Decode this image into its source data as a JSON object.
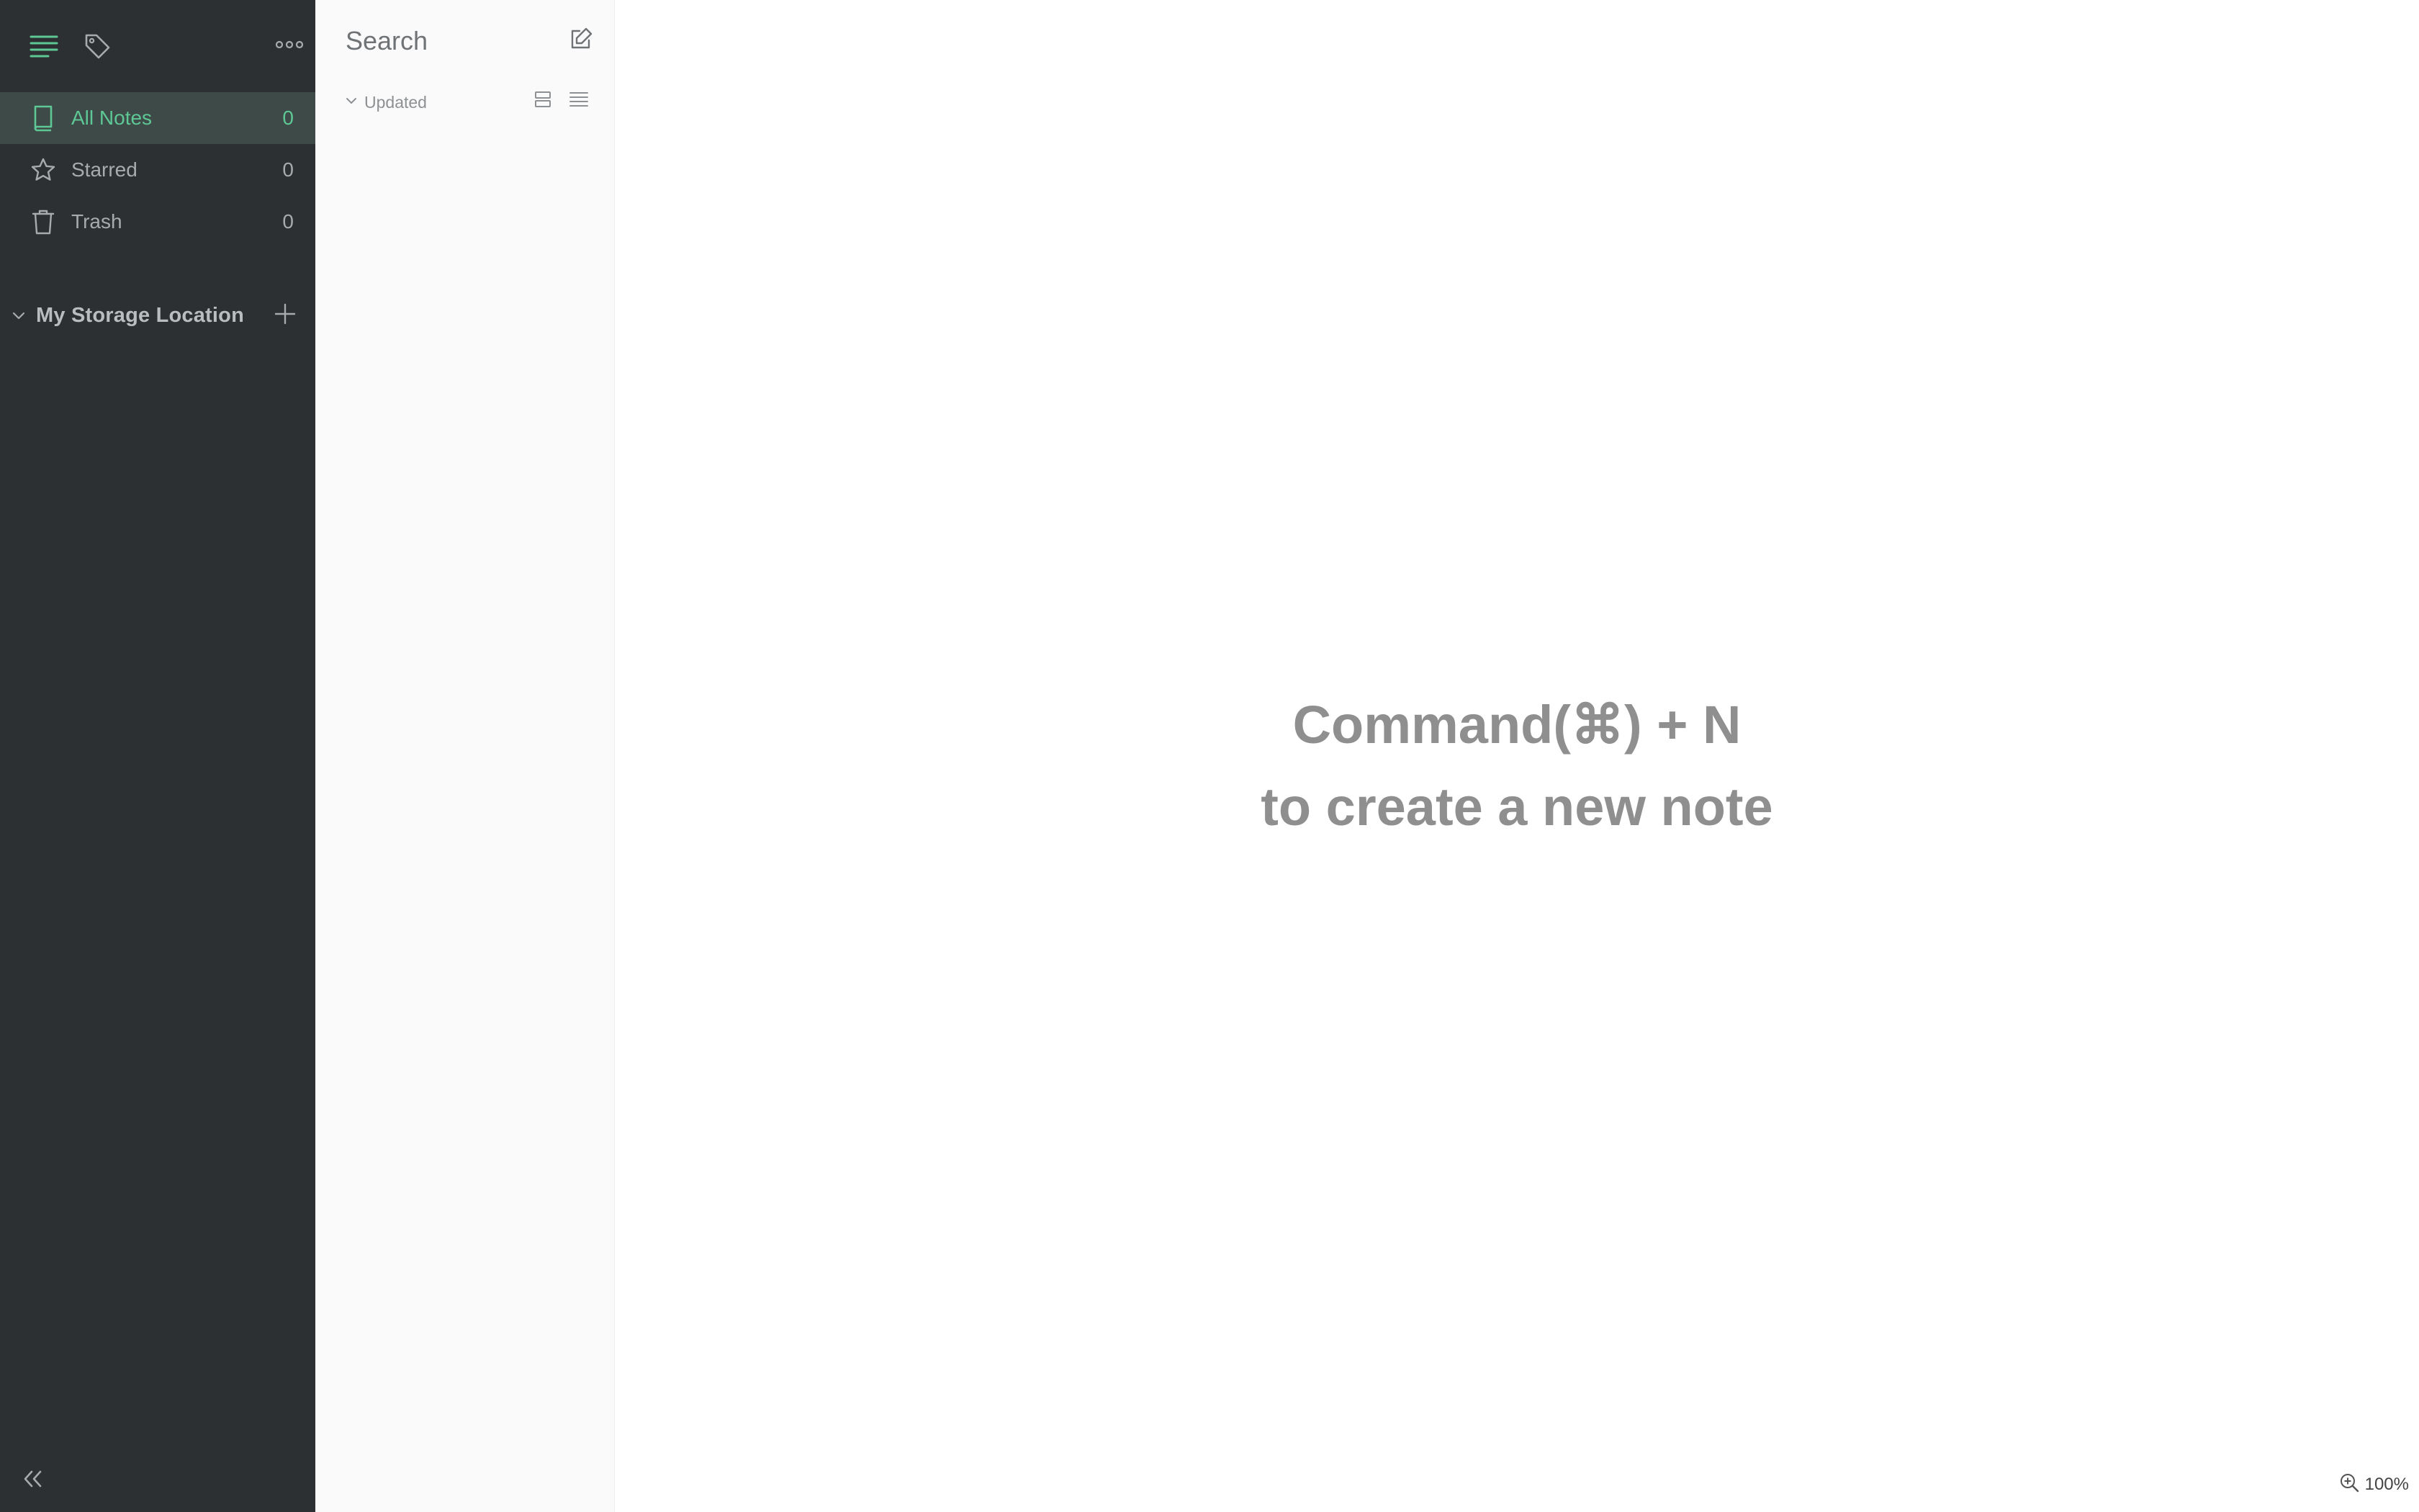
{
  "sidebar": {
    "top_icons": [
      "notes-list-icon",
      "tag-icon",
      "more-options-icon"
    ],
    "nav": [
      {
        "label": "All Notes",
        "count": "0",
        "icon": "book-icon",
        "active": true
      },
      {
        "label": "Starred",
        "count": "0",
        "icon": "star-icon",
        "active": false
      },
      {
        "label": "Trash",
        "count": "0",
        "icon": "trash-icon",
        "active": false
      }
    ],
    "storage": {
      "label": "My Storage Location"
    },
    "collapse_icon": "double-chevron-left-icon"
  },
  "notelist": {
    "search_label": "Search",
    "sort_label": "Updated"
  },
  "main": {
    "empty_line1": "Command(⌘) + N",
    "empty_line2": "to create a new note",
    "zoom": "100%"
  },
  "colors": {
    "sidebar_bg": "#2c3033",
    "accent": "#5ec796",
    "active_bg": "#3d4a47",
    "notelist_bg": "#fafafa",
    "message": "#8f8f8f"
  }
}
